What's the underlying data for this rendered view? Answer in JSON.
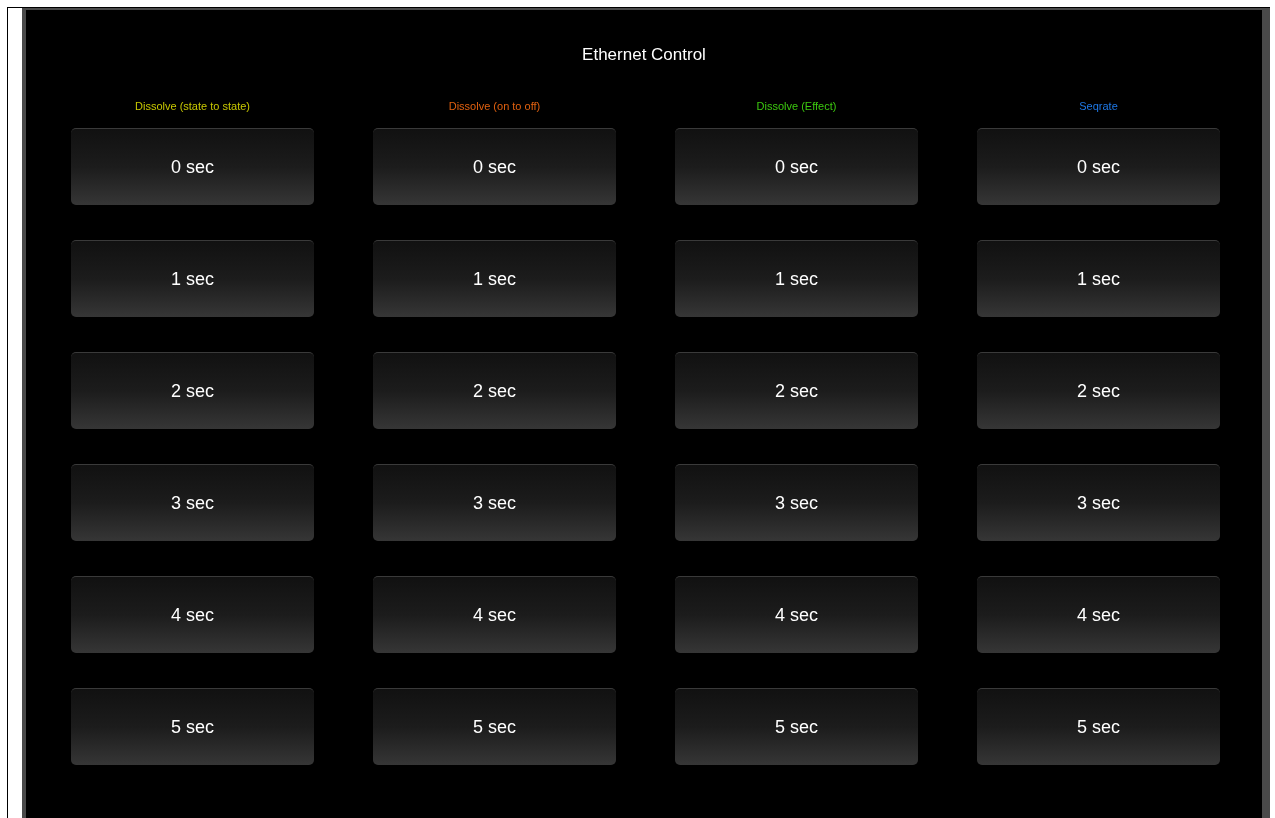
{
  "title": "Ethernet Control",
  "columns": [
    {
      "heading": "Dissolve (state to state)",
      "color": "#c8c800",
      "buttons": [
        "0 sec",
        "1 sec",
        "2 sec",
        "3 sec",
        "4 sec",
        "5 sec"
      ]
    },
    {
      "heading": "Dissolve (on to off)",
      "color": "#e0600f",
      "buttons": [
        "0 sec",
        "1 sec",
        "2 sec",
        "3 sec",
        "4 sec",
        "5 sec"
      ]
    },
    {
      "heading": "Dissolve (Effect)",
      "color": "#3cc80f",
      "buttons": [
        "0 sec",
        "1 sec",
        "2 sec",
        "3 sec",
        "4 sec",
        "5 sec"
      ]
    },
    {
      "heading": "Seqrate",
      "color": "#1e78e6",
      "buttons": [
        "0 sec",
        "1 sec",
        "2 sec",
        "3 sec",
        "4 sec",
        "5 sec"
      ]
    }
  ]
}
